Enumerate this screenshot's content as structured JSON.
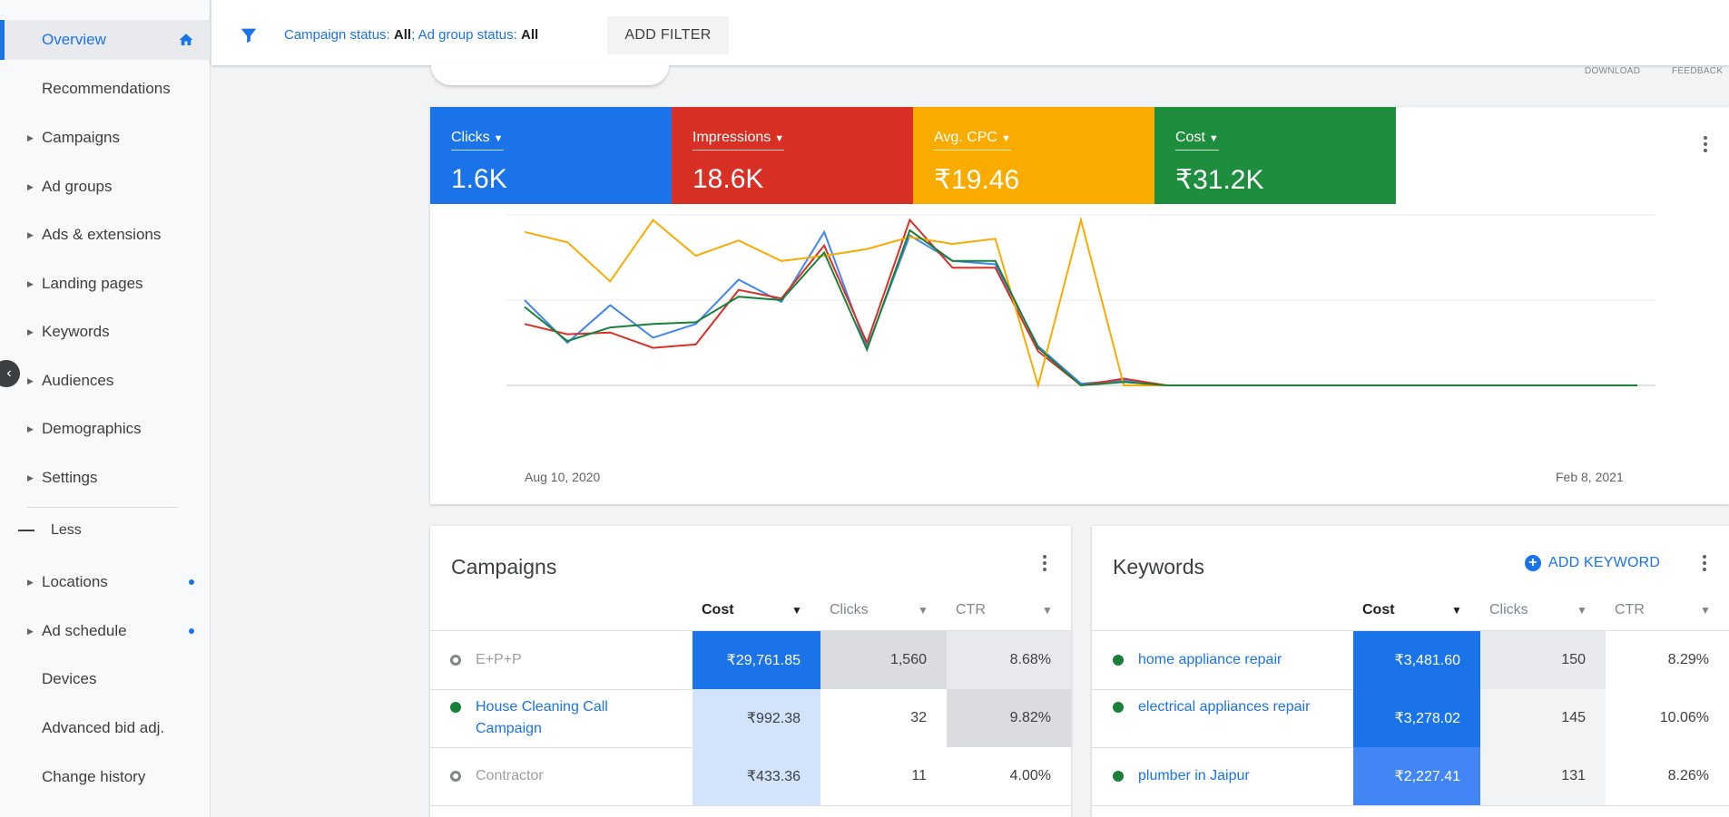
{
  "sidebar": {
    "items": [
      {
        "label": "Overview",
        "active": true,
        "icon": "home-icon"
      },
      {
        "label": "Recommendations"
      },
      {
        "label": "Campaigns",
        "expandable": true
      },
      {
        "label": "Ad groups",
        "expandable": true
      },
      {
        "label": "Ads & extensions",
        "expandable": true
      },
      {
        "label": "Landing pages",
        "expandable": true
      },
      {
        "label": "Keywords",
        "expandable": true
      },
      {
        "label": "Audiences",
        "expandable": true
      },
      {
        "label": "Demographics",
        "expandable": true
      },
      {
        "label": "Settings",
        "expandable": true
      }
    ],
    "less_label": "Less",
    "more_items": [
      {
        "label": "Locations",
        "expandable": true,
        "dot": true
      },
      {
        "label": "Ad schedule",
        "expandable": true,
        "dot": true
      },
      {
        "label": "Devices"
      },
      {
        "label": "Advanced bid adj."
      },
      {
        "label": "Change history"
      }
    ]
  },
  "filter": {
    "campaign_label": "Campaign status: ",
    "campaign_value": "All",
    "adgroup_label": "; Ad group status: ",
    "adgroup_value": "All",
    "add_filter": "ADD FILTER"
  },
  "toplinks": {
    "download": "DOWNLOAD",
    "feedback": "FEEDBACK"
  },
  "colors": {
    "clicks": "#1a73e8",
    "impressions": "#d93025",
    "avg_cpc": "#f9ab00",
    "cost": "#1e8e3e"
  },
  "metrics": [
    {
      "label": "Clicks",
      "value": "1.6K",
      "color": "#1a73e8"
    },
    {
      "label": "Impressions",
      "value": "18.6K",
      "color": "#d93025"
    },
    {
      "label": "Avg. CPC",
      "value": "₹19.46",
      "color": "#f9ab00"
    },
    {
      "label": "Cost",
      "value": "₹31.2K",
      "color": "#1e8e3e"
    }
  ],
  "chart_data": {
    "type": "line",
    "x_start_label": "Aug 10, 2020",
    "x_end_label": "Feb 8, 2021",
    "ylim": [
      0,
      100
    ],
    "grid": true,
    "series": [
      {
        "name": "Clicks",
        "color": "#4285f4",
        "values": [
          50,
          25,
          47,
          28,
          36,
          62,
          49,
          90,
          22,
          88,
          73,
          71,
          23,
          1,
          3,
          0,
          0,
          0,
          0,
          0,
          0,
          0,
          0,
          0,
          0,
          0,
          0
        ]
      },
      {
        "name": "Impressions",
        "color": "#d93025",
        "values": [
          36,
          30,
          31,
          22,
          24,
          56,
          51,
          82,
          25,
          97,
          69,
          69,
          20,
          0,
          4,
          0,
          0,
          0,
          0,
          0,
          0,
          0,
          0,
          0,
          0,
          0,
          0
        ]
      },
      {
        "name": "Avg. CPC",
        "color": "#f9ab00",
        "values": [
          90,
          84,
          61,
          97,
          76,
          85,
          73,
          76,
          80,
          87,
          83,
          86,
          0,
          97,
          0,
          0,
          0,
          0,
          0,
          0,
          0,
          0,
          0,
          0,
          0,
          0,
          0
        ]
      },
      {
        "name": "Cost",
        "color": "#188038",
        "values": [
          46,
          26,
          34,
          36,
          37,
          52,
          50,
          78,
          21,
          91,
          73,
          73,
          22,
          0,
          2,
          0,
          0,
          0,
          0,
          0,
          0,
          0,
          0,
          0,
          0,
          0,
          0
        ]
      }
    ]
  },
  "campaigns": {
    "title": "Campaigns",
    "columns": [
      "Cost",
      "Clicks",
      "CTR"
    ],
    "rows": [
      {
        "name": "E+P+P",
        "status": "paused",
        "cost": "₹29,761.85",
        "clicks": "1,560",
        "ctr": "8.68%",
        "cost_shade": 1.0,
        "clicks_shade": 0.6,
        "ctr_shade": 0.4
      },
      {
        "name": "House Cleaning Call Campaign",
        "status": "enabled",
        "cost": "₹992.38",
        "clicks": "32",
        "ctr": "9.82%",
        "cost_shade": 0.12,
        "clicks_shade": 0,
        "ctr_shade": 0.6
      },
      {
        "name": "Contractor",
        "status": "paused",
        "cost": "₹433.36",
        "clicks": "11",
        "ctr": "4.00%",
        "cost_shade": 0.1,
        "clicks_shade": 0,
        "ctr_shade": 0
      }
    ]
  },
  "keywords": {
    "title": "Keywords",
    "add_label": "ADD KEYWORD",
    "columns": [
      "Cost",
      "Clicks",
      "CTR"
    ],
    "rows": [
      {
        "name": "home appliance repair",
        "status": "enabled",
        "cost": "₹3,481.60",
        "clicks": "150",
        "ctr": "8.29%",
        "cost_shade": 1.0,
        "clicks_shade": 0.35,
        "ctr_shade": 0
      },
      {
        "name": "electrical appliances repair",
        "status": "enabled",
        "cost": "₹3,278.02",
        "clicks": "145",
        "ctr": "10.06%",
        "cost_shade": 0.92,
        "clicks_shade": 0.25,
        "ctr_shade": 0
      },
      {
        "name": "plumber in Jaipur",
        "status": "enabled",
        "cost": "₹2,227.41",
        "clicks": "131",
        "ctr": "8.26%",
        "cost_shade": 0.65,
        "clicks_shade": 0.15,
        "ctr_shade": 0
      }
    ]
  }
}
